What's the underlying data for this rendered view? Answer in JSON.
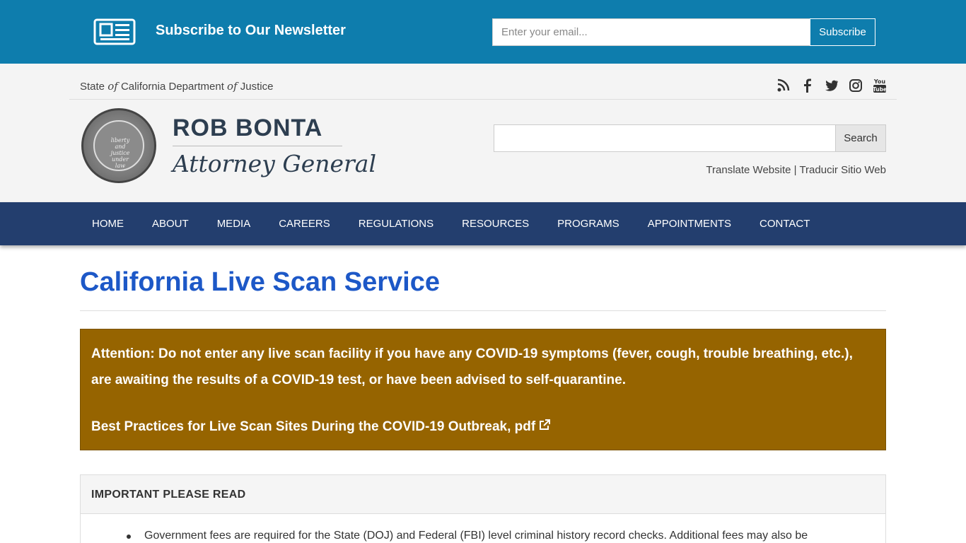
{
  "newsletter": {
    "icon": "newspaper-icon",
    "title": "Subscribe to Our Newsletter",
    "email_placeholder": "Enter your email...",
    "subscribe_label": "Subscribe"
  },
  "header": {
    "agency_prefix": "State ",
    "agency_of1": "of",
    "agency_mid": " California Department ",
    "agency_of2": "of",
    "agency_suffix": " Justice",
    "social": [
      "rss-icon",
      "facebook-icon",
      "twitter-icon",
      "instagram-icon",
      "youtube-icon"
    ],
    "seal_text": "liberty and justice under law",
    "name": "ROB BONTA",
    "title": "Attorney General",
    "search_button": "Search",
    "translate_en": "Translate Website",
    "separator": " | ",
    "translate_es": "Traducir Sitio Web"
  },
  "nav": {
    "items": [
      "HOME",
      "ABOUT",
      "MEDIA",
      "CAREERS",
      "REGULATIONS",
      "RESOURCES",
      "PROGRAMS",
      "APPOINTMENTS",
      "CONTACT"
    ]
  },
  "main": {
    "title": "California Live Scan Service",
    "alert": {
      "text": "Attention: Do not enter any live scan facility if you have any COVID-19 symptoms (fever, cough, trouble breathing, etc.), are awaiting the results of a COVID-19 test, or have been advised to self-quarantine.",
      "link": "Best Practices for Live Scan Sites During the COVID-19 Outbreak, pdf",
      "color": "#966400"
    },
    "panel": {
      "heading": "IMPORTANT PLEASE READ",
      "items": [
        "Government fees are required for the State (DOJ) and Federal (FBI) level criminal history record checks. Additional fees may also be"
      ]
    }
  },
  "colors": {
    "newsletter_bg": "#0e7dad",
    "nav_bg": "#233e6e",
    "title": "#1d58c7"
  }
}
